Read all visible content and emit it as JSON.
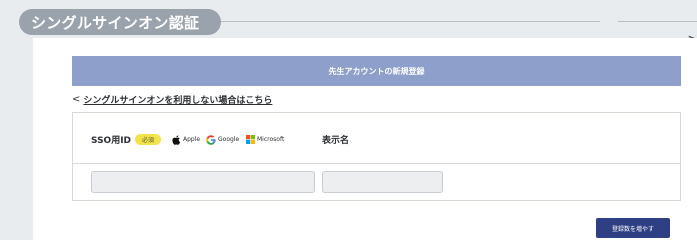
{
  "section": {
    "title": "シングルサインオン認証"
  },
  "header": {
    "title": "先生アカウントの新規登録"
  },
  "back_link": {
    "chevron": "<",
    "label": "シングルサインオンを利用しない場合はこちら"
  },
  "form": {
    "sso_id_label": "SSO用ID",
    "required_badge": "必須",
    "providers": [
      {
        "name": "Apple",
        "icon": "apple-icon"
      },
      {
        "name": "Google",
        "icon": "google-icon"
      },
      {
        "name": "Microsoft",
        "icon": "microsoft-icon"
      }
    ],
    "display_name_label": "表示名",
    "sso_id_value": "",
    "display_name_value": ""
  },
  "actions": {
    "add_button_label": "登録数を増やす"
  },
  "colors": {
    "header_bar": "#8e9fcb",
    "primary_button": "#2e3f84",
    "required_badge": "#f2e34a",
    "section_pill": "#9aa3ab"
  }
}
